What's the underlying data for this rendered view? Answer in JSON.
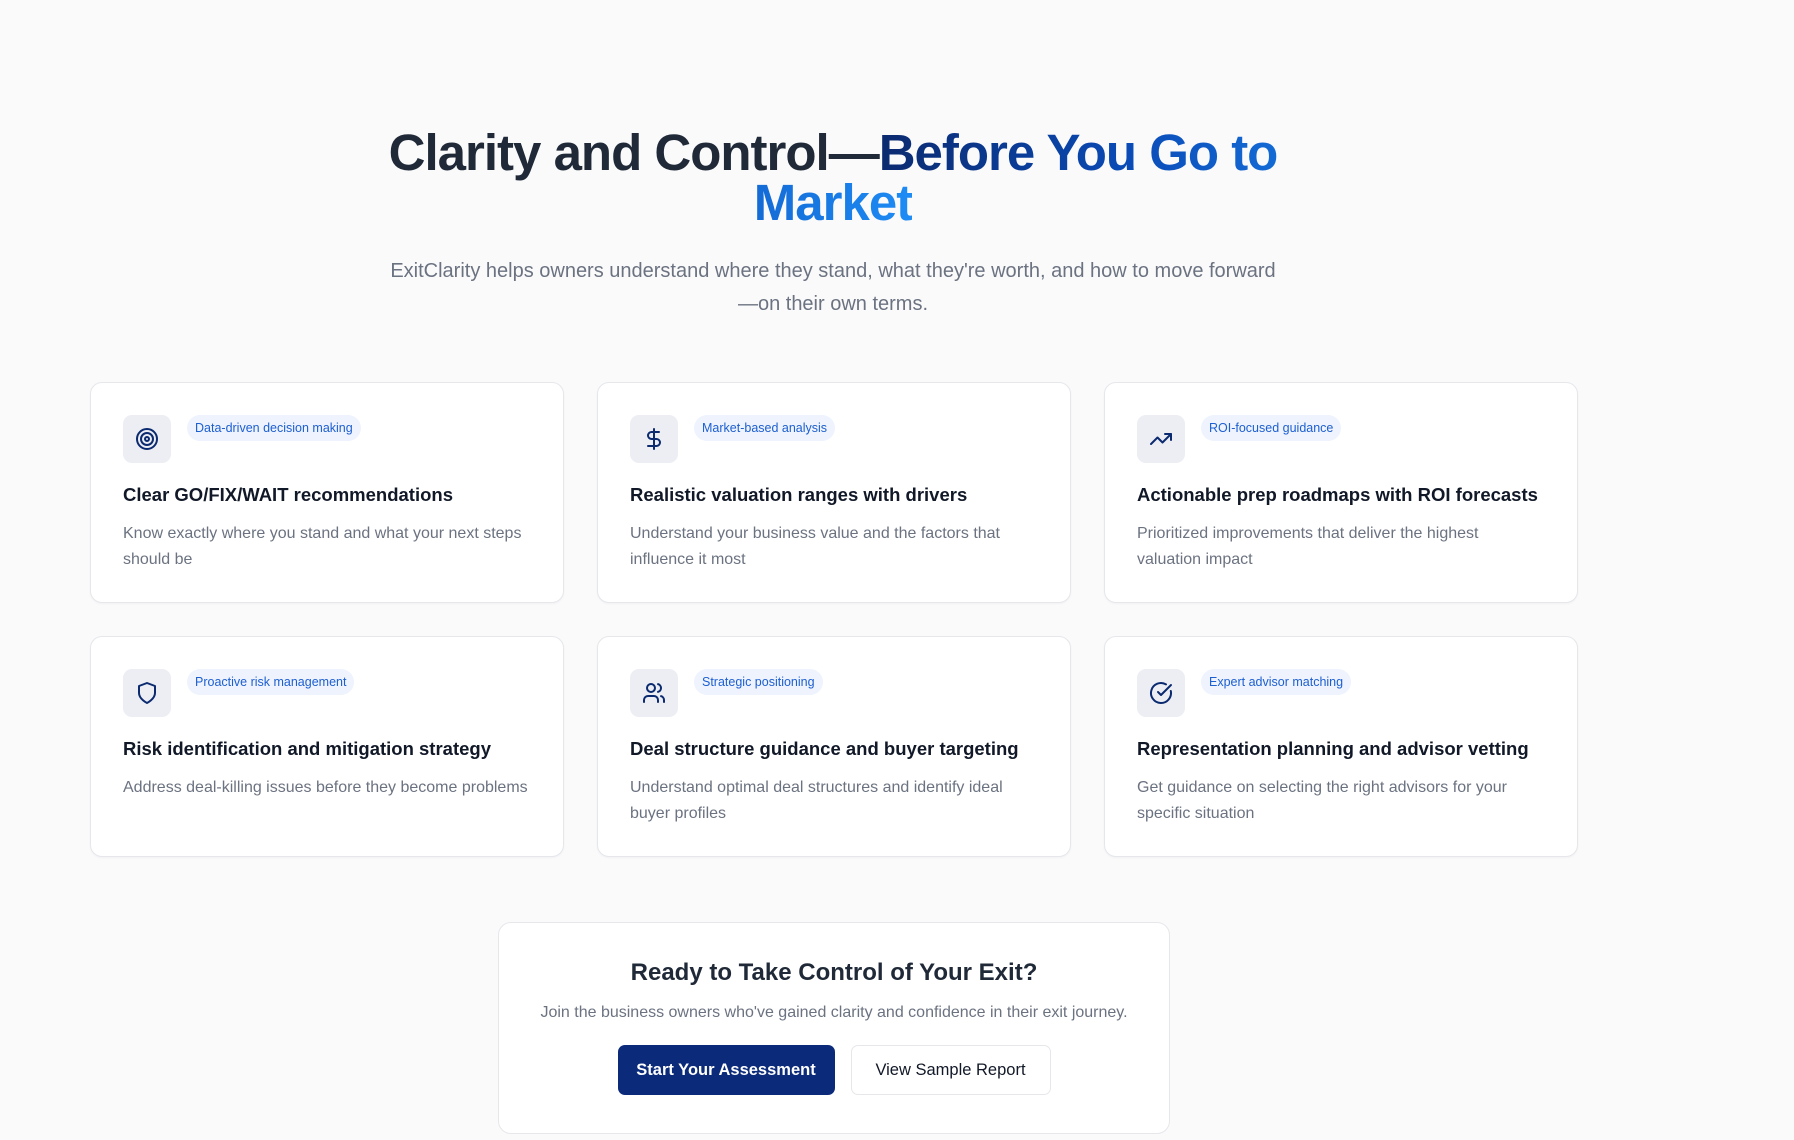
{
  "hero": {
    "title_plain": "Clarity and Control—",
    "title_accent": "Before You Go to Market",
    "subtitle": "ExitClarity helps owners understand where they stand, what they're worth, and how to move forward—on their own terms."
  },
  "features": [
    {
      "icon": "target-icon",
      "badge": "Data-driven decision making",
      "title": "Clear GO/FIX/WAIT recommendations",
      "desc": "Know exactly where you stand and what your next steps should be"
    },
    {
      "icon": "dollar-icon",
      "badge": "Market-based analysis",
      "title": "Realistic valuation ranges with drivers",
      "desc": "Understand your business value and the factors that influence it most"
    },
    {
      "icon": "trending-up-icon",
      "badge": "ROI-focused guidance",
      "title": "Actionable prep roadmaps with ROI forecasts",
      "desc": "Prioritized improvements that deliver the highest valuation impact"
    },
    {
      "icon": "shield-icon",
      "badge": "Proactive risk management",
      "title": "Risk identification and mitigation strategy",
      "desc": "Address deal-killing issues before they become problems"
    },
    {
      "icon": "users-icon",
      "badge": "Strategic positioning",
      "title": "Deal structure guidance and buyer targeting",
      "desc": "Understand optimal deal structures and identify ideal buyer profiles"
    },
    {
      "icon": "check-circle-icon",
      "badge": "Expert advisor matching",
      "title": "Representation planning and advisor vetting",
      "desc": "Get guidance on selecting the right advisors for your specific situation"
    }
  ],
  "cta": {
    "title": "Ready to Take Control of Your Exit?",
    "subtitle": "Join the business owners who've gained clarity and confidence in their exit journey.",
    "primary_label": "Start Your Assessment",
    "secondary_label": "View Sample Report"
  },
  "colors": {
    "brand_dark": "#0b2a7a",
    "accent_light": "#1e8cf5",
    "badge_bg": "#eef3fd",
    "badge_text": "#1d5fd1"
  }
}
